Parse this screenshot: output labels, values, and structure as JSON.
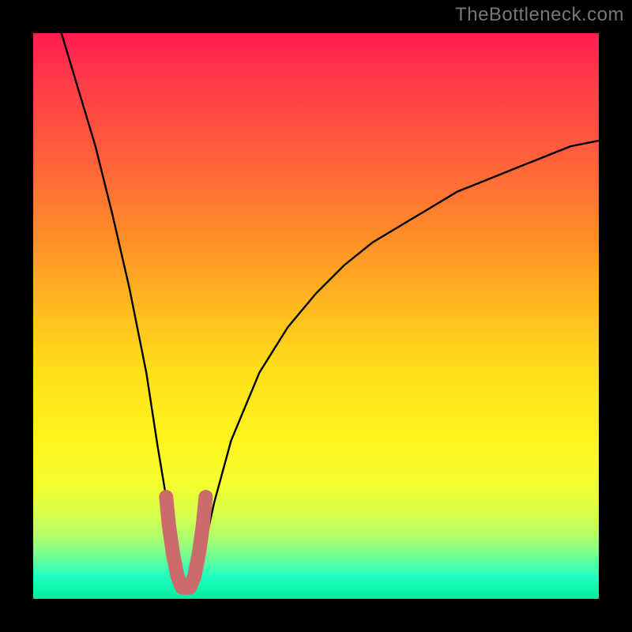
{
  "watermark": "TheBottleneck.com",
  "chart_data": {
    "type": "line",
    "title": "",
    "xlabel": "",
    "ylabel": "",
    "xlim": [
      0,
      100
    ],
    "ylim": [
      0,
      100
    ],
    "grid": false,
    "series": [
      {
        "name": "bottleneck-curve",
        "x": [
          5,
          8,
          11,
          14,
          17,
          20,
          22,
          24,
          25,
          26,
          27,
          28,
          29,
          30,
          32,
          35,
          40,
          45,
          50,
          55,
          60,
          65,
          70,
          75,
          80,
          85,
          90,
          95,
          100
        ],
        "values": [
          100,
          90,
          80,
          68,
          55,
          40,
          27,
          15,
          8,
          3,
          1,
          1,
          3,
          8,
          17,
          28,
          40,
          48,
          54,
          59,
          63,
          66,
          69,
          72,
          74,
          76,
          78,
          80,
          81
        ]
      }
    ],
    "highlight": {
      "name": "valley-marker",
      "color": "#cc6b6b",
      "x": [
        23.5,
        24,
        24.7,
        25.5,
        26.3,
        27.0,
        27.7,
        28.5,
        29.3,
        30.0,
        30.5
      ],
      "values": [
        18,
        13,
        8,
        4,
        2,
        2,
        2,
        4,
        8,
        13,
        18
      ]
    }
  }
}
